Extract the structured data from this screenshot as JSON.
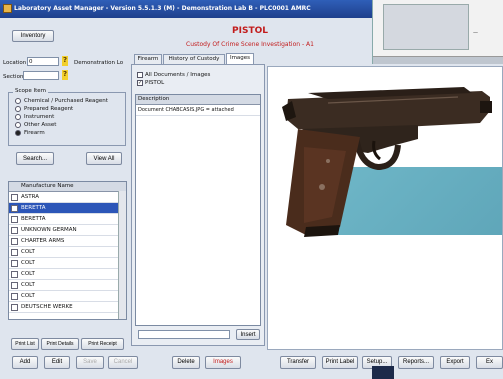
{
  "window": {
    "title": "Laboratory Asset Manager - Version 5.5.1.3 (M) - Demonstration Lab B - PLC0001 AMRC"
  },
  "toolbar": {
    "inventory_label": "Inventory"
  },
  "header": {
    "item_title": "PISTOL",
    "subtitle": "Custody Of Crime Scene Investigation - A1"
  },
  "location": {
    "label": "Location",
    "value": "0",
    "display": "Demonstration Lo"
  },
  "section": {
    "label": "Section",
    "value": ""
  },
  "scope": {
    "label": "Scope Item",
    "options": [
      {
        "label": "Chemical / Purchased Reagent",
        "selected": false
      },
      {
        "label": "Prepared Reagent",
        "selected": false
      },
      {
        "label": "Instrument",
        "selected": false
      },
      {
        "label": "Other Asset",
        "selected": false
      },
      {
        "label": "Firearm",
        "selected": true
      }
    ]
  },
  "actions": {
    "search_label": "Search...",
    "view_all_label": "View All"
  },
  "manufacturers": {
    "header": "Manufacture Name",
    "rows": [
      {
        "name": "ASTRA",
        "selected": false
      },
      {
        "name": "BERETTA",
        "selected": true
      },
      {
        "name": "BERETTA",
        "selected": false
      },
      {
        "name": "UNKNOWN GERMAN",
        "selected": false
      },
      {
        "name": "CHARTER ARMS",
        "selected": false
      },
      {
        "name": "COLT",
        "selected": false
      },
      {
        "name": "COLT",
        "selected": false
      },
      {
        "name": "COLT",
        "selected": false
      },
      {
        "name": "COLT",
        "selected": false
      },
      {
        "name": "COLT",
        "selected": false
      },
      {
        "name": "DEUTSCHE WERKE",
        "selected": false
      }
    ]
  },
  "print_buttons": {
    "print_list": "Print List",
    "print_details": "Print Details",
    "print_receipt": "Print Receipt"
  },
  "tabs": [
    {
      "label": "Firearm",
      "active": false
    },
    {
      "label": "History of Custody",
      "active": false
    },
    {
      "label": "Images",
      "active": true
    }
  ],
  "images_tab": {
    "all_docs_label": "All Documents / Images",
    "pistol_label": "PISTOL",
    "desc_header": "Description",
    "desc_row": "Document CHABCASIS.JPG = attached",
    "insert_label": "Insert"
  },
  "bottom_buttons": {
    "add": "Add",
    "edit": "Edit",
    "save": "Save",
    "cancel": "Cancel",
    "delete": "Delete",
    "images": "Images",
    "transfer": "Transfer",
    "print_label": "Print Label",
    "setup": "Setup...",
    "reports": "Reports...",
    "export": "Export",
    "exit": "Ex"
  },
  "colors": {
    "title_red": "#c21c1c",
    "titlebar_blue": "#2f5fb8",
    "selected_row": "#2c56b8"
  }
}
